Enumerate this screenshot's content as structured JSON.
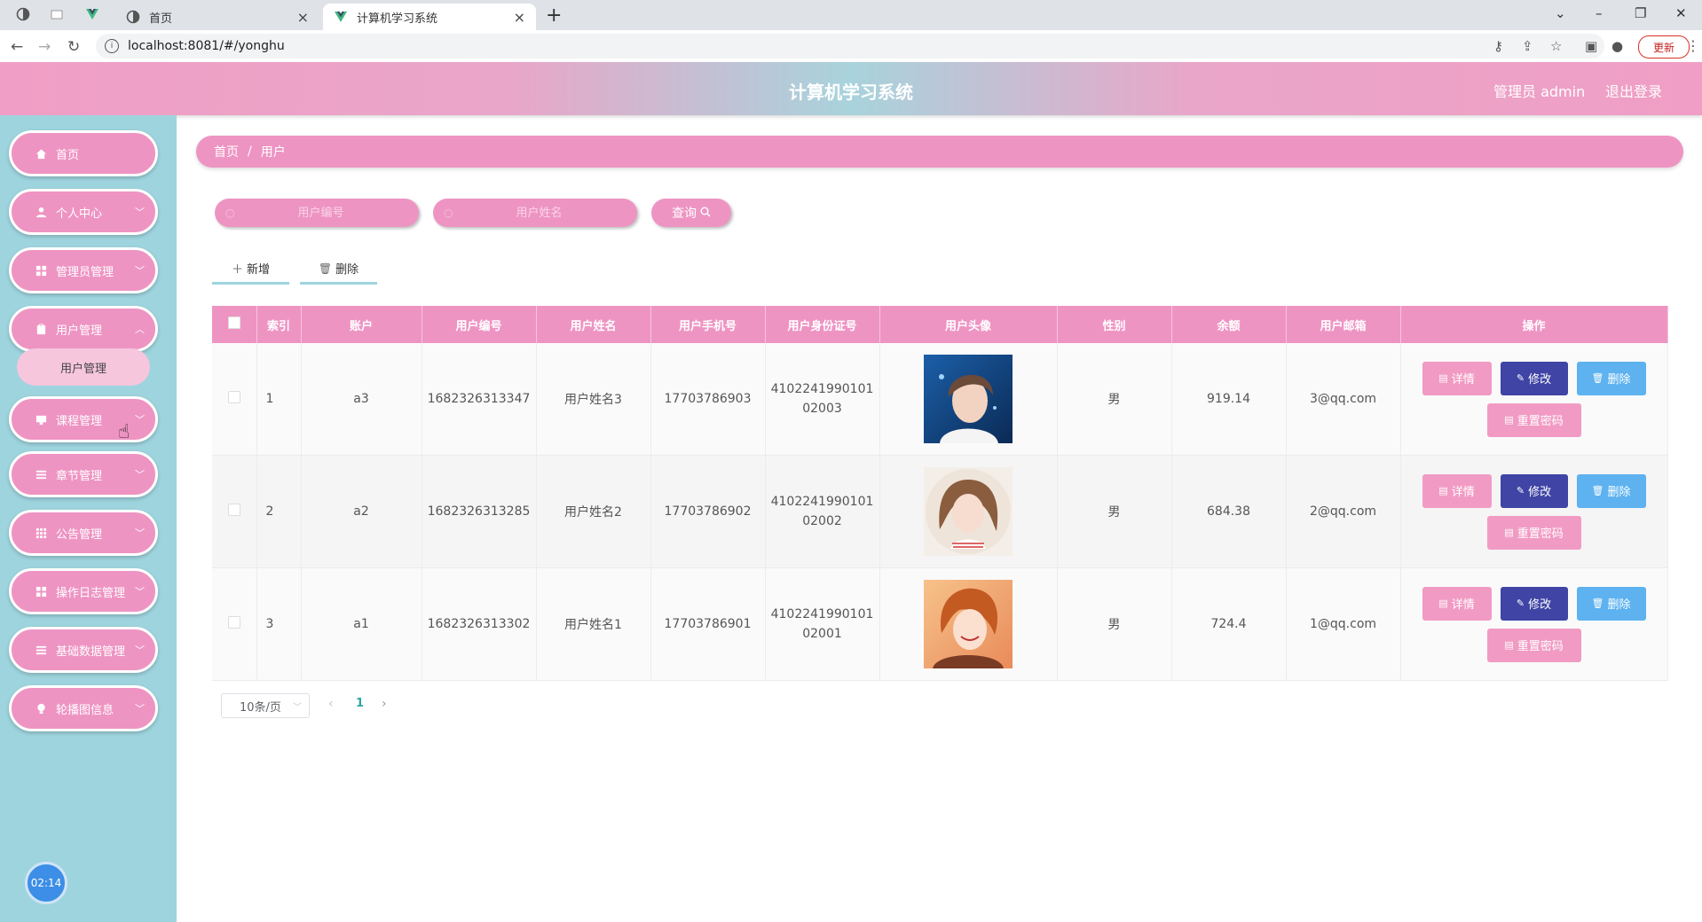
{
  "browser": {
    "inactive_tab_label": "首页",
    "active_tab_label": "计算机学习系统",
    "url": "localhost:8081/#/yonghu",
    "update_label": "更新"
  },
  "header": {
    "title": "计算机学习系统",
    "user_label": "管理员 admin",
    "logout_label": "退出登录"
  },
  "sidebar": {
    "items": [
      {
        "label": "首页",
        "icon": "home-icon"
      },
      {
        "label": "个人中心",
        "icon": "user-icon"
      },
      {
        "label": "管理员管理",
        "icon": "grid-icon"
      },
      {
        "label": "用户管理",
        "icon": "clipboard-icon"
      },
      {
        "label": "课程管理",
        "icon": "monitor-icon"
      },
      {
        "label": "章节管理",
        "icon": "list-icon"
      },
      {
        "label": "公告管理",
        "icon": "apps-icon"
      },
      {
        "label": "操作日志管理",
        "icon": "grid-icon"
      },
      {
        "label": "基础数据管理",
        "icon": "list-icon"
      },
      {
        "label": "轮播图信息",
        "icon": "bulb-icon"
      }
    ],
    "submenu_label": "用户管理",
    "clock": "02:14"
  },
  "breadcrumb": {
    "home": "首页",
    "separator": "/",
    "current": "用户"
  },
  "search": {
    "placeholder_code": "用户编号",
    "placeholder_name": "用户姓名",
    "query_label": "查询"
  },
  "toolbar": {
    "add_label": "新增",
    "delete_label": "删除"
  },
  "table": {
    "headers": [
      "索引",
      "账户",
      "用户编号",
      "用户姓名",
      "用户手机号",
      "用户身份证号",
      "用户头像",
      "性别",
      "余额",
      "用户邮箱",
      "操作"
    ],
    "rows": [
      {
        "index": "1",
        "account": "a3",
        "code": "1682326313347",
        "name": "用户姓名3",
        "phone": "17703786903",
        "idcard_l1": "4102241990101",
        "idcard_l2": "02003",
        "gender": "男",
        "balance": "919.14",
        "email": "3@qq.com"
      },
      {
        "index": "2",
        "account": "a2",
        "code": "1682326313285",
        "name": "用户姓名2",
        "phone": "17703786902",
        "idcard_l1": "4102241990101",
        "idcard_l2": "02002",
        "gender": "男",
        "balance": "684.38",
        "email": "2@qq.com"
      },
      {
        "index": "3",
        "account": "a1",
        "code": "1682326313302",
        "name": "用户姓名1",
        "phone": "17703786901",
        "idcard_l1": "4102241990101",
        "idcard_l2": "02001",
        "gender": "男",
        "balance": "724.4",
        "email": "1@qq.com"
      }
    ],
    "actions": {
      "detail": "详情",
      "edit": "修改",
      "delete": "删除",
      "reset": "重置密码"
    }
  },
  "pagination": {
    "page_size": "10条/页",
    "current_page": "1"
  },
  "colors": {
    "accent_pink": "#ee94c3",
    "sidebar_teal": "#9ed4de",
    "edit_blue": "#3f44a5",
    "delete_blue": "#5db2ef"
  }
}
